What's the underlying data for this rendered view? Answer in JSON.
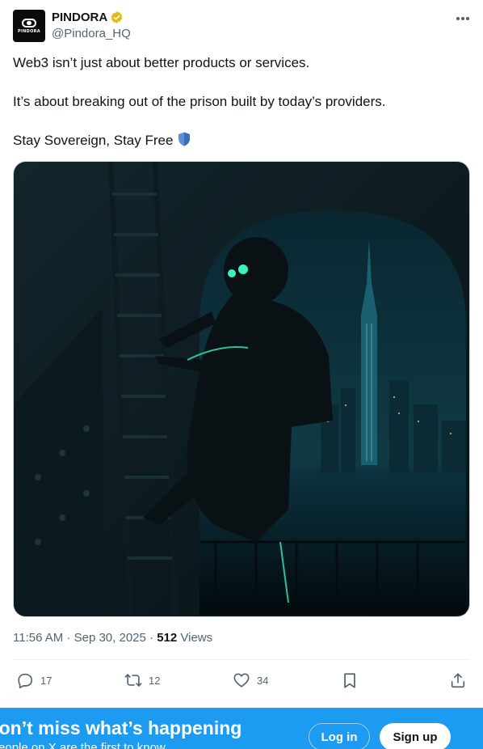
{
  "author": {
    "display_name": "PINDORA",
    "handle": "@Pindora_HQ",
    "avatar_text": "PINDORA",
    "verified_color": "#e2b719"
  },
  "tweet": {
    "lines": [
      "Web3 isn’t just about better products or services.",
      "",
      "It’s about breaking out of the prison built by today’s providers.",
      "",
      "Stay Sovereign, Stay Free"
    ],
    "emoji": "shield-icon"
  },
  "meta": {
    "time": "11:56 AM",
    "sep1": " · ",
    "date": "Sep 30, 2025",
    "sep2": " · ",
    "views_count": "512",
    "views_label": " Views"
  },
  "actions": {
    "replies": "17",
    "reposts": "12",
    "likes": "34"
  },
  "banner": {
    "title": "Don’t miss what’s happening",
    "subtitle": "People on X are the first to know.",
    "login_label": "Log in",
    "signup_label": "Sign up",
    "background": "#1d9bf0"
  }
}
